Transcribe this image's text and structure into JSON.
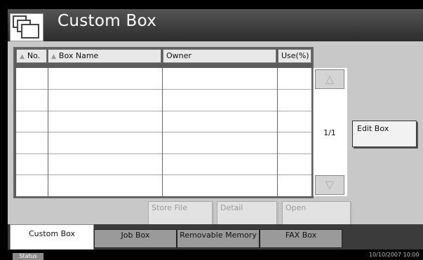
{
  "title": "Custom Box",
  "table": {
    "headers": [
      {
        "label": "No.",
        "sortable": true
      },
      {
        "label": "Box Name",
        "sortable": true
      },
      {
        "label": "Owner",
        "sortable": false
      },
      {
        "label": "Use(%)",
        "sortable": false
      }
    ],
    "rows": [
      "",
      "",
      "",
      "",
      "",
      ""
    ]
  },
  "pagination": {
    "page": "1/1"
  },
  "buttons": {
    "edit_box": "Edit Box",
    "store_file": "Store File",
    "detail": "Detail",
    "open": "Open"
  },
  "tabs": [
    {
      "label": "Custom Box",
      "active": true
    },
    {
      "label": "Job Box",
      "active": false
    },
    {
      "label": "Removable Memory",
      "active": false
    },
    {
      "label": "FAX Box",
      "active": false
    }
  ],
  "status": {
    "label": "Status",
    "datetime": "10/10/2007 10:00"
  }
}
